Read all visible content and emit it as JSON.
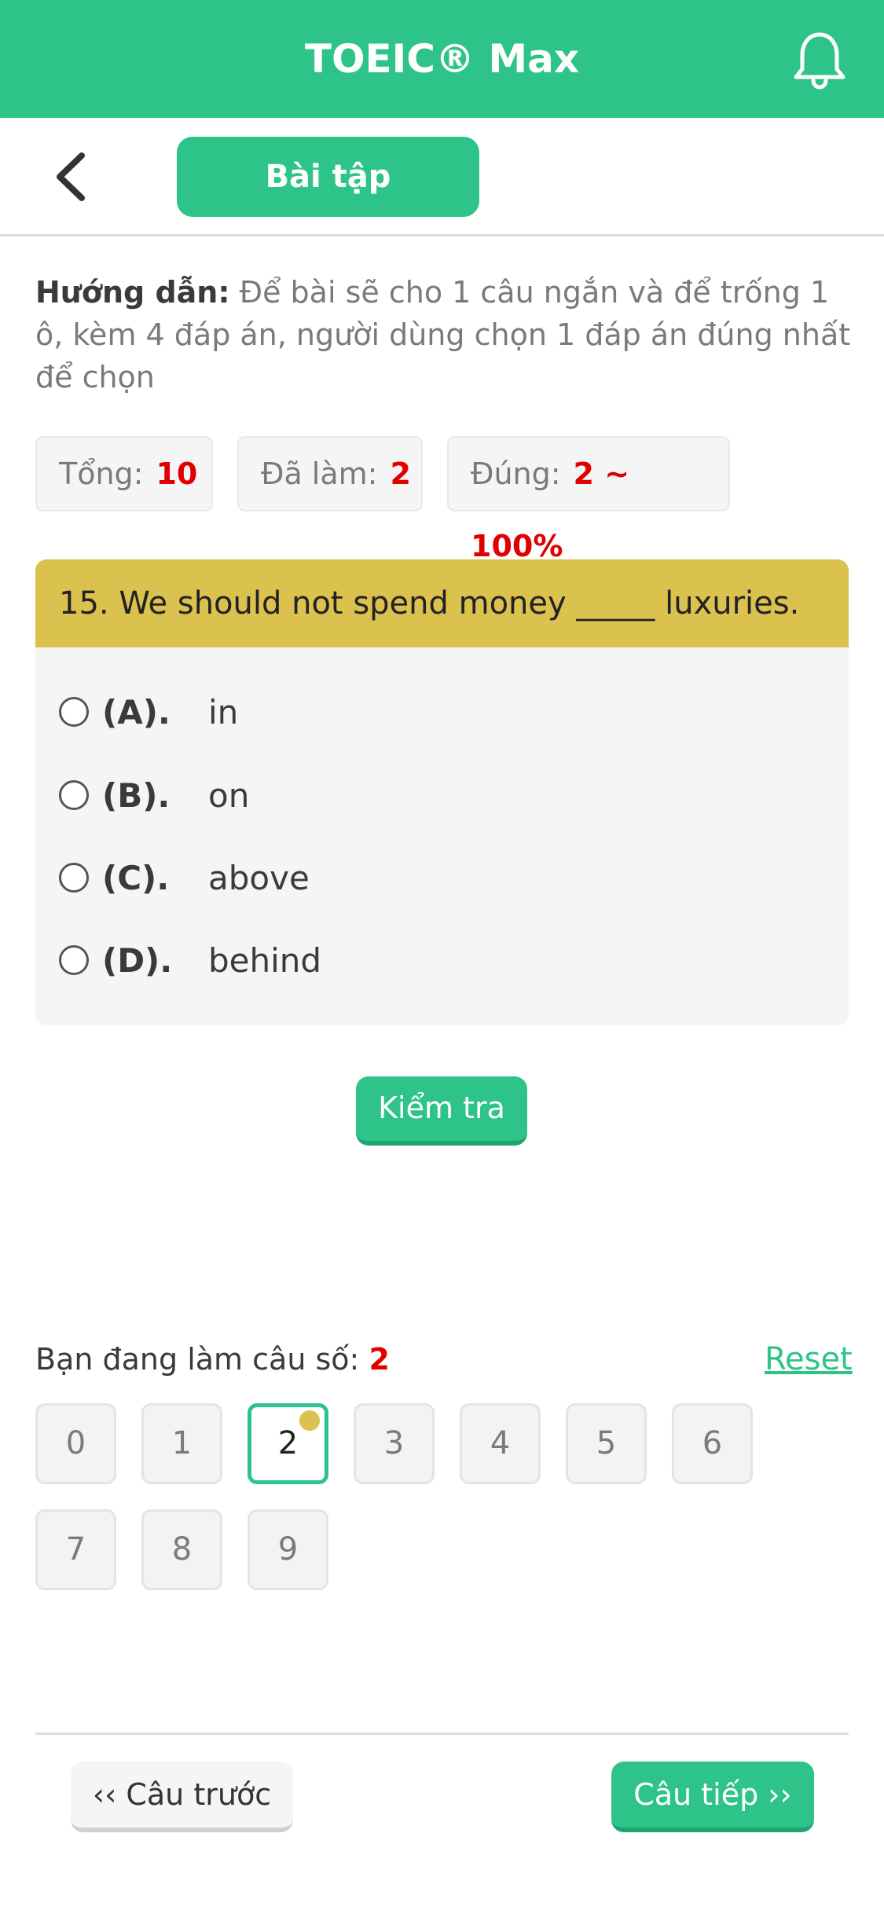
{
  "app": {
    "title": "TOEIC® Max"
  },
  "toolbar": {
    "tab_label": "Bài tập"
  },
  "guide": {
    "label": "Hướng dẫn:",
    "text": "Để bài sẽ cho 1 câu ngắn và để trống 1 ô, kèm 4 đáp án, người dùng chọn 1 đáp án đúng nhất để chọn"
  },
  "stats": {
    "total_label": "Tổng:",
    "total_value": "10",
    "done_label": "Đã làm:",
    "done_value": "2",
    "correct_label": "Đúng:",
    "correct_value": "2 ~ 100%"
  },
  "question": {
    "text": "15. We should not spend money _____ luxuries.",
    "options": [
      {
        "key": "(A).",
        "text": "in"
      },
      {
        "key": "(B).",
        "text": "on"
      },
      {
        "key": "(C).",
        "text": "above"
      },
      {
        "key": "(D).",
        "text": "behind"
      }
    ]
  },
  "check_label": "Kiểm tra",
  "progress": {
    "label": "Bạn đang làm câu số:",
    "current": "2",
    "reset_label": "Reset"
  },
  "numbers": [
    "0",
    "1",
    "2",
    "3",
    "4",
    "5",
    "6",
    "7",
    "8",
    "9"
  ],
  "nav": {
    "prev_label": "‹‹ Câu trước",
    "next_label": "Câu tiếp ››"
  },
  "colors": {
    "brand": "#2ec489",
    "question_header": "#dbc14e",
    "highlight_value": "#e10000"
  }
}
